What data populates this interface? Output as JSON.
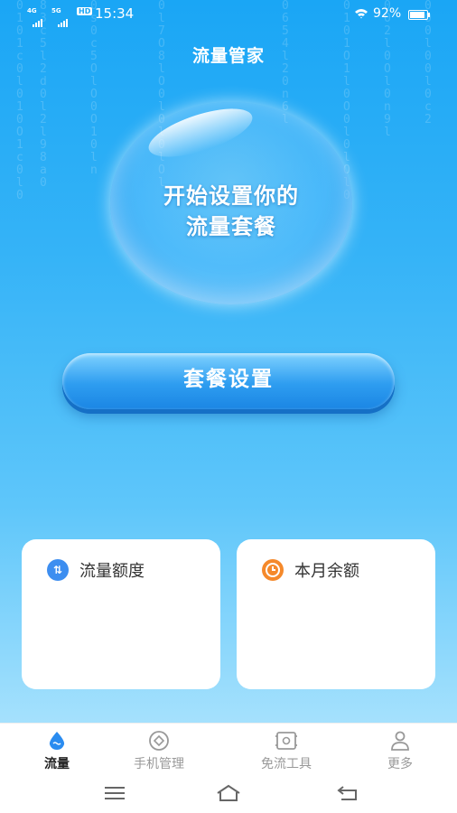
{
  "status_bar": {
    "network_label": "4G",
    "network2_label": "5G",
    "hd_label": "HD",
    "time": "15:34",
    "battery_pct": "92%",
    "battery_level": 0.92
  },
  "header": {
    "title": "流量管家"
  },
  "bubble": {
    "line1": "开始设置你的",
    "line2": "流量套餐"
  },
  "setup_button": {
    "label": "套餐设置"
  },
  "cards": [
    {
      "label": "流量额度",
      "icon": "data-quota-icon",
      "color": "#3d8ef0"
    },
    {
      "label": "本月余额",
      "icon": "clock-icon",
      "color": "#f5892b"
    }
  ],
  "tabbar": {
    "items": [
      {
        "label": "流量",
        "icon": "water-drop-icon",
        "active": true
      },
      {
        "label": "手机管理",
        "icon": "phone-manage-icon",
        "active": false
      },
      {
        "label": "免流工具",
        "icon": "tool-icon",
        "active": false
      },
      {
        "label": "更多",
        "icon": "person-icon",
        "active": false
      }
    ]
  },
  "colors": {
    "accent": "#1aa6f5",
    "active_tab": "#2a8cf0",
    "inactive_tab": "#999999"
  }
}
